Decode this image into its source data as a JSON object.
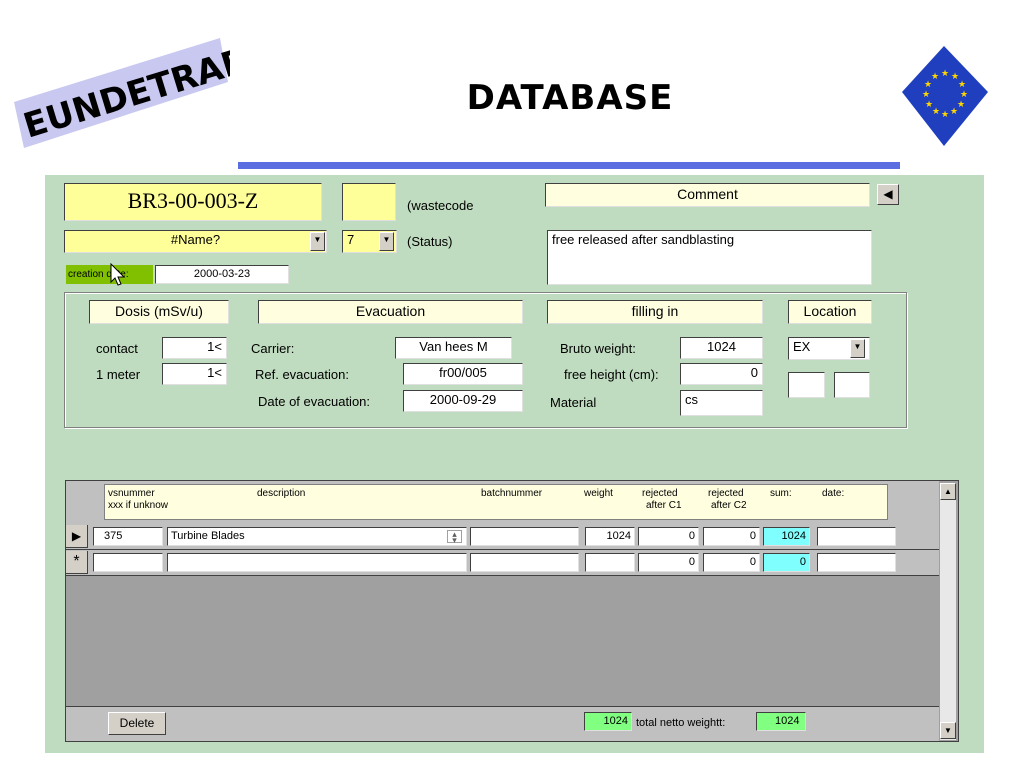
{
  "slide": {
    "logo_text": "EUNDETRAF",
    "title": "DATABASE",
    "colors": {
      "rule": "#5b6ee1",
      "eu_blue": "#1f3fbf",
      "eu_star": "#ffd700"
    }
  },
  "form": {
    "background": "#c0dcc0",
    "code": "BR3-00-003-Z",
    "wastecode_value": "",
    "wastecode_label": "(wastecode",
    "name_value": "#Name?",
    "status_value": "7",
    "status_label": "(Status)",
    "comment_header": "Comment",
    "comment_text": "free released after sandblasting",
    "creation_label": "creation date:",
    "creation_date": "2000-03-23",
    "dosis": {
      "header": "Dosis (mSv/u)",
      "contact_label": "contact",
      "contact_value": "1<",
      "meter_label": "1 meter",
      "meter_value": "1<"
    },
    "evacuation": {
      "header": "Evacuation",
      "carrier_label": "Carrier:",
      "carrier_value": "Van hees M",
      "ref_label": "Ref. evacuation:",
      "ref_value": "fr00/005",
      "date_label": "Date of evacuation:",
      "date_value": "2000-09-29"
    },
    "filling": {
      "header": "filling in",
      "bruto_label": "Bruto weight:",
      "bruto_value": "1024",
      "height_label": "free height (cm):",
      "height_value": "0",
      "material_label": "Material",
      "material_value": "cs"
    },
    "location": {
      "header": "Location",
      "value": "EX",
      "box1": "",
      "box2": ""
    }
  },
  "grid": {
    "headers": {
      "vsnummer": "vsnummer",
      "vsnummer_sub": "xxx if unknow",
      "description": "description",
      "batchnummer": "batchnummer",
      "weight": "weight",
      "rejected_c1": "rejected",
      "rejected_c1_sub": "after C1",
      "rejected_c2": "rejected",
      "rejected_c2_sub": "after C2",
      "sum": "sum:",
      "date": "date:"
    },
    "rows": [
      {
        "selector": "▶",
        "vsnummer": "375",
        "description": "Turbine Blades",
        "batchnummer": "",
        "weight": "1024",
        "rej_c1": "0",
        "rej_c2": "0",
        "sum": "1024",
        "date": ""
      },
      {
        "selector": "*",
        "vsnummer": "",
        "description": "",
        "batchnummer": "",
        "weight": "",
        "rej_c1": "0",
        "rej_c2": "0",
        "sum": "0",
        "date": ""
      }
    ],
    "footer": {
      "delete_label": "Delete",
      "total_left": "1024",
      "total_label": "total netto weightt:",
      "total_right": "1024"
    }
  }
}
